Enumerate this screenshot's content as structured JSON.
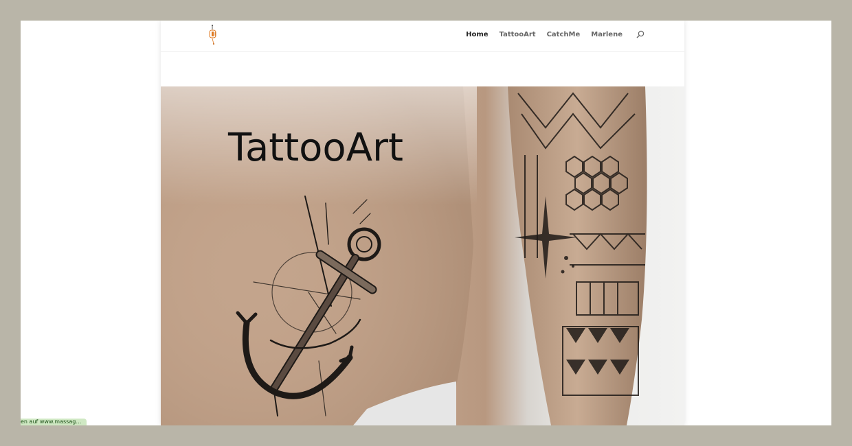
{
  "nav": {
    "items": [
      {
        "label": "Home",
        "active": true
      },
      {
        "label": "TattooArt",
        "active": false
      },
      {
        "label": "CatchMe",
        "active": false
      },
      {
        "label": "Marlene",
        "active": false
      }
    ],
    "search_icon": "search-icon"
  },
  "hero": {
    "title": "TattooArt"
  },
  "status_bar": {
    "text": "en auf www.massageim..."
  },
  "colors": {
    "frame": "#b9b5a8",
    "nav_active": "#222222",
    "nav_default": "#666666",
    "status_bg": "#cfe8c3"
  }
}
